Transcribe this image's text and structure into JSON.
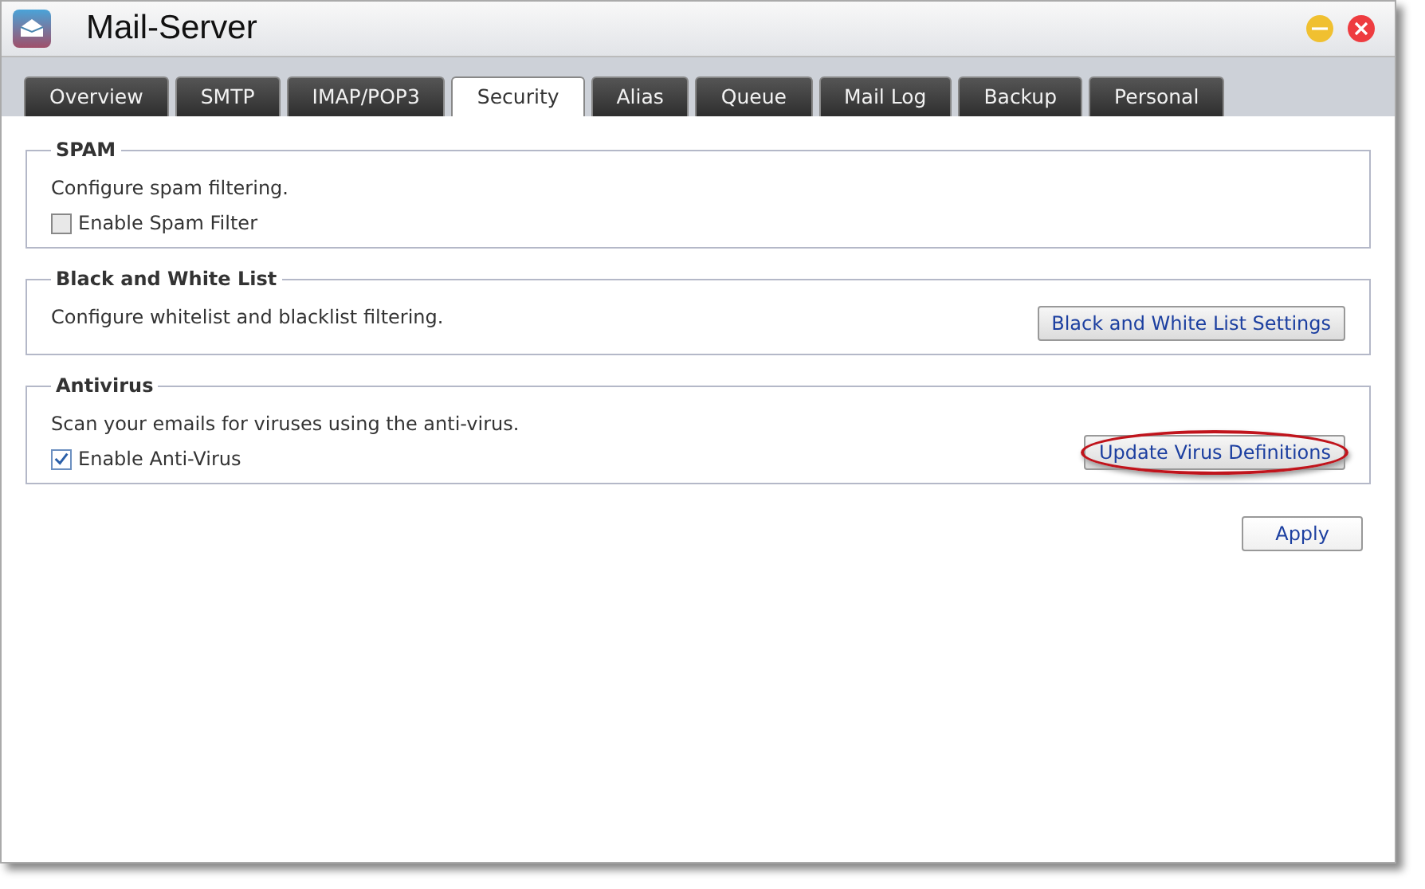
{
  "window": {
    "title": "Mail-Server"
  },
  "tabs": [
    {
      "label": "Overview",
      "selected": false
    },
    {
      "label": "SMTP",
      "selected": false
    },
    {
      "label": "IMAP/POP3",
      "selected": false
    },
    {
      "label": "Security",
      "selected": true
    },
    {
      "label": "Alias",
      "selected": false
    },
    {
      "label": "Queue",
      "selected": false
    },
    {
      "label": "Mail Log",
      "selected": false
    },
    {
      "label": "Backup",
      "selected": false
    },
    {
      "label": "Personal",
      "selected": false
    }
  ],
  "sections": [
    {
      "title": "SPAM",
      "description": "Configure spam filtering.",
      "checkbox": {
        "label": "Enable Spam Filter",
        "checked": false
      }
    },
    {
      "title": "Black and White List",
      "description": "Configure whitelist and blacklist filtering.",
      "button": {
        "label": "Black and White List Settings",
        "highlighted": false
      }
    },
    {
      "title": "Antivirus",
      "description": "Scan your emails for viruses using the anti-virus.",
      "checkbox": {
        "label": "Enable Anti-Virus",
        "checked": true
      },
      "button": {
        "label": "Update Virus Definitions",
        "highlighted": true
      }
    }
  ],
  "apply_button": "Apply"
}
